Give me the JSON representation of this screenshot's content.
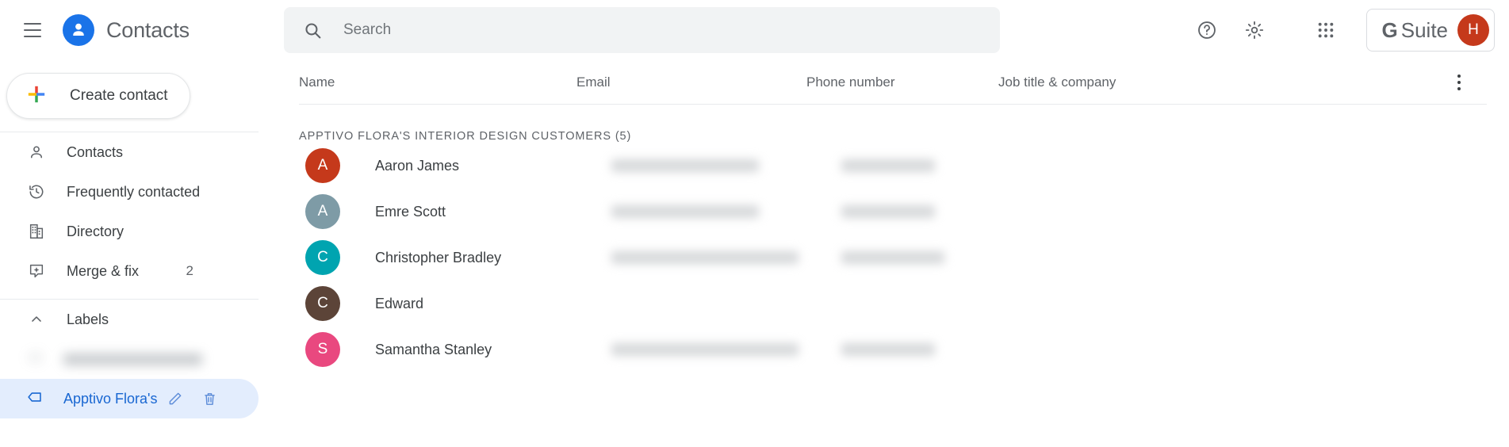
{
  "app": {
    "title": "Contacts",
    "hamburger_icon": "hamburger-menu-icon",
    "logo_icon": "contacts-person-logo-icon"
  },
  "search": {
    "placeholder": "Search",
    "value": "",
    "icon": "search-icon"
  },
  "top_actions": {
    "help_icon": "help-circle-icon",
    "settings_icon": "gear-icon",
    "apps_icon": "apps-grid-icon",
    "gsuite_g": "G",
    "gsuite_label": "Suite",
    "account_initial": "H",
    "account_color": "#c5391b"
  },
  "sidebar": {
    "create_label": "Create contact",
    "create_icon": "google-plus-icon",
    "items": [
      {
        "label": "Contacts",
        "icon": "person-outline-icon",
        "count": ""
      },
      {
        "label": "Frequently contacted",
        "icon": "history-clock-icon",
        "count": ""
      },
      {
        "label": "Directory",
        "icon": "building-icon",
        "count": ""
      },
      {
        "label": "Merge & fix",
        "icon": "merge-sparkle-icon",
        "count": "2"
      }
    ],
    "labels_section": {
      "header": "Labels",
      "collapse_icon": "chevron-up-icon",
      "items": [
        {
          "name": "",
          "redacted": true,
          "selected": false
        },
        {
          "name": "Apptivo Flora's In",
          "redacted": false,
          "selected": true,
          "edit_icon": "pencil-icon",
          "delete_icon": "trash-icon"
        }
      ]
    }
  },
  "main": {
    "columns": [
      "Name",
      "Email",
      "Phone number",
      "Job title & company"
    ],
    "more_menu_icon": "kebab-menu-icon",
    "group_title": "APPTIVO FLORA'S INTERIOR DESIGN CUSTOMERS (5)",
    "rows": [
      {
        "name": "Aaron James",
        "initial": "A",
        "avatar_color": "#c5391b",
        "email": "",
        "email_redacted": true,
        "email_w": 186,
        "phone": "",
        "phone_redacted": true,
        "phone_w": 118
      },
      {
        "name": "Emre Scott",
        "initial": "A",
        "avatar_color": "#7e9ba6",
        "email": "",
        "email_redacted": true,
        "email_w": 186,
        "phone": "",
        "phone_redacted": true,
        "phone_w": 118
      },
      {
        "name": "Christopher Bradley",
        "initial": "C",
        "avatar_color": "#00a4b0",
        "email": "",
        "email_redacted": true,
        "email_w": 236,
        "phone": "",
        "phone_redacted": true,
        "phone_w": 130
      },
      {
        "name": "Edward",
        "initial": "C",
        "avatar_color": "#5c4438",
        "email": "",
        "email_redacted": false,
        "email_w": 0,
        "phone": "",
        "phone_redacted": false,
        "phone_w": 0
      },
      {
        "name": "Samantha Stanley",
        "initial": "S",
        "avatar_color": "#e9487f",
        "email": "",
        "email_redacted": true,
        "email_w": 236,
        "phone": "",
        "phone_redacted": true,
        "phone_w": 118
      }
    ]
  }
}
